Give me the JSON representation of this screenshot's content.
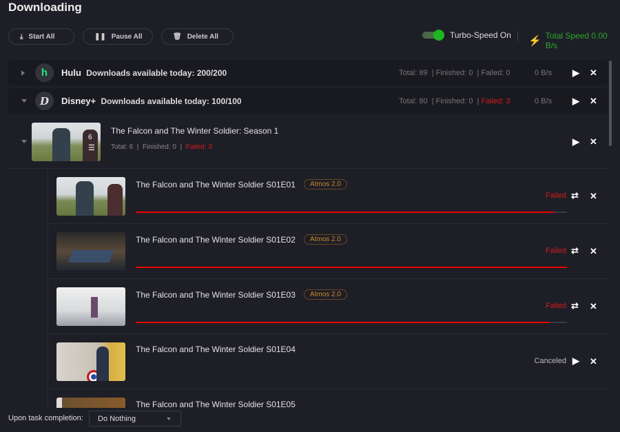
{
  "header": {
    "title": "Downloading",
    "start_all": "Start All",
    "pause_all": "Pause All",
    "delete_all": "Delete All",
    "turbo_label": "Turbo-Speed On",
    "turbo_on": true,
    "total_speed": "Total Speed 0.00 B/s"
  },
  "colors": {
    "accent_green": "#1fb51f",
    "failed_red": "#d41c1c",
    "badge_orange": "#c98a2a"
  },
  "services": [
    {
      "name": "Hulu",
      "logo": "h",
      "available": "Downloads available today: 200/200",
      "total": "Total: 89",
      "finished": "Finished: 0",
      "failed": "Failed: 0",
      "speed": "0 B/s",
      "expanded": false
    },
    {
      "name": "Disney+",
      "logo": "D",
      "available": "Downloads available today: 100/100",
      "total": "Total: 80",
      "finished": "Finished: 0",
      "failed": "Failed: 3",
      "speed": "0 B/s",
      "expanded": true
    }
  ],
  "season": {
    "title": "The Falcon and The Winter Soldier: Season 1",
    "count": "6",
    "total": "Total: 6",
    "finished": "Finished: 0",
    "failed": "Failed: 3"
  },
  "episodes": [
    {
      "title": "The Falcon and The Winter Soldier S01E01",
      "badge": "Atmos 2.0",
      "status": "Failed",
      "progress": 0.97
    },
    {
      "title": "The Falcon and The Winter Soldier S01E02",
      "badge": "Atmos 2.0",
      "status": "Failed",
      "progress": 1.0
    },
    {
      "title": "The Falcon and The Winter Soldier S01E03",
      "badge": "Atmos 2.0",
      "status": "Failed",
      "progress": 0.96
    },
    {
      "title": "The Falcon and The Winter Soldier S01E04",
      "status": "Canceled"
    },
    {
      "title": "The Falcon and The Winter Soldier S01E05"
    }
  ],
  "footer": {
    "label": "Upon task completion:",
    "option": "Do Nothing"
  }
}
